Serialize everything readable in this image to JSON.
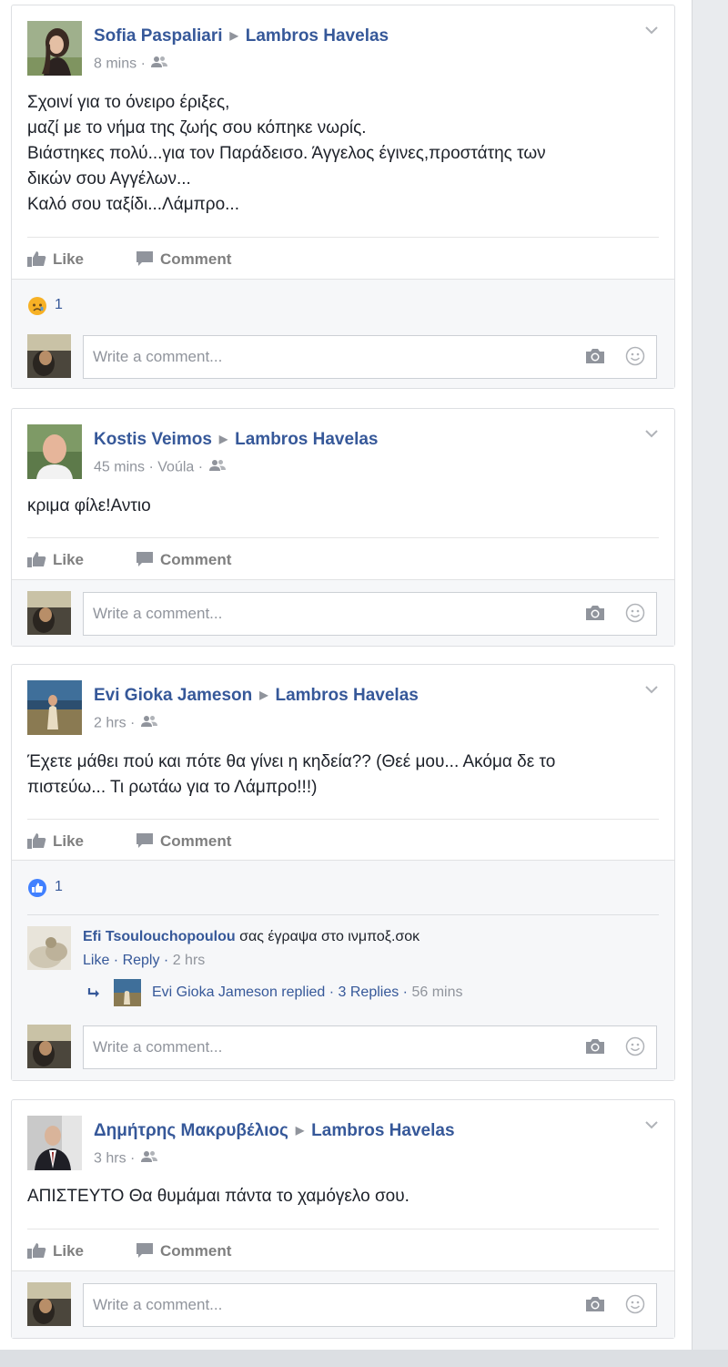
{
  "colors": {
    "link_blue": "#365899",
    "grey_text": "#90949c",
    "body_text": "#1d2129",
    "action_grey": "#7f7f7f",
    "like_blue": "#4080ff",
    "sad_yellow": "#f7b125"
  },
  "posts": [
    {
      "author": "Sofia Paspaliari",
      "target": "Lambros Havelas",
      "time": "8 mins",
      "with": "",
      "lines": [
        "Σχοινί για το όνειρο έριξες,",
        "μαζί με το νήμα της ζωής σου κόπηκε νωρίς.",
        "Βιάστηκες πολύ...για τον Παράδεισο. Άγγελος έγινες,προστάτης των",
        "δικών σου Αγγέλων...",
        "Καλό σου ταξίδι...Λάμπρο..."
      ],
      "like_label": "Like",
      "comment_label": "Comment",
      "reaction_icon": "sad-reaction-icon",
      "reaction_count": "1",
      "comment_placeholder": "Write a comment..."
    },
    {
      "author": "Kostis Veimos",
      "target": "Lambros Havelas",
      "time": "45 mins",
      "with": "Voúla",
      "lines": [
        "κριμα φίλε!Αντιο"
      ],
      "like_label": "Like",
      "comment_label": "Comment",
      "comment_placeholder": "Write a comment..."
    },
    {
      "author": "Evi Gioka Jameson",
      "target": "Lambros Havelas",
      "time": "2 hrs",
      "with": "",
      "lines": [
        "Έχετε μάθει πού και πότε θα γίνει η κηδεία?? (Θεέ μου... Ακόμα δε το",
        "πιστεύω... Τι ρωτάω για το Λάμπρο!!!)"
      ],
      "like_label": "Like",
      "comment_label": "Comment",
      "reaction_icon": "like-reaction-icon",
      "reaction_count": "1",
      "reply": {
        "name": "Efi Tsoulouchopoulou",
        "text": "σας έγραψα στο ινμποξ.σοκ",
        "like": "Like",
        "reply": "Reply",
        "time": "2 hrs",
        "summary_name": "Evi Gioka Jameson replied",
        "summary_count": "3 Replies",
        "summary_time": "56 mins"
      },
      "comment_placeholder": "Write a comment..."
    },
    {
      "author": "Δημήτρης Μακρυβέλιος",
      "target": "Lambros Havelas",
      "time": "3 hrs",
      "with": "",
      "lines": [
        "ΑΠΙΣΤΕΥΤΟ Θα θυμάμαι πάντα το χαμόγελο σου."
      ],
      "like_label": "Like",
      "comment_label": "Comment",
      "comment_placeholder": "Write a comment..."
    }
  ]
}
